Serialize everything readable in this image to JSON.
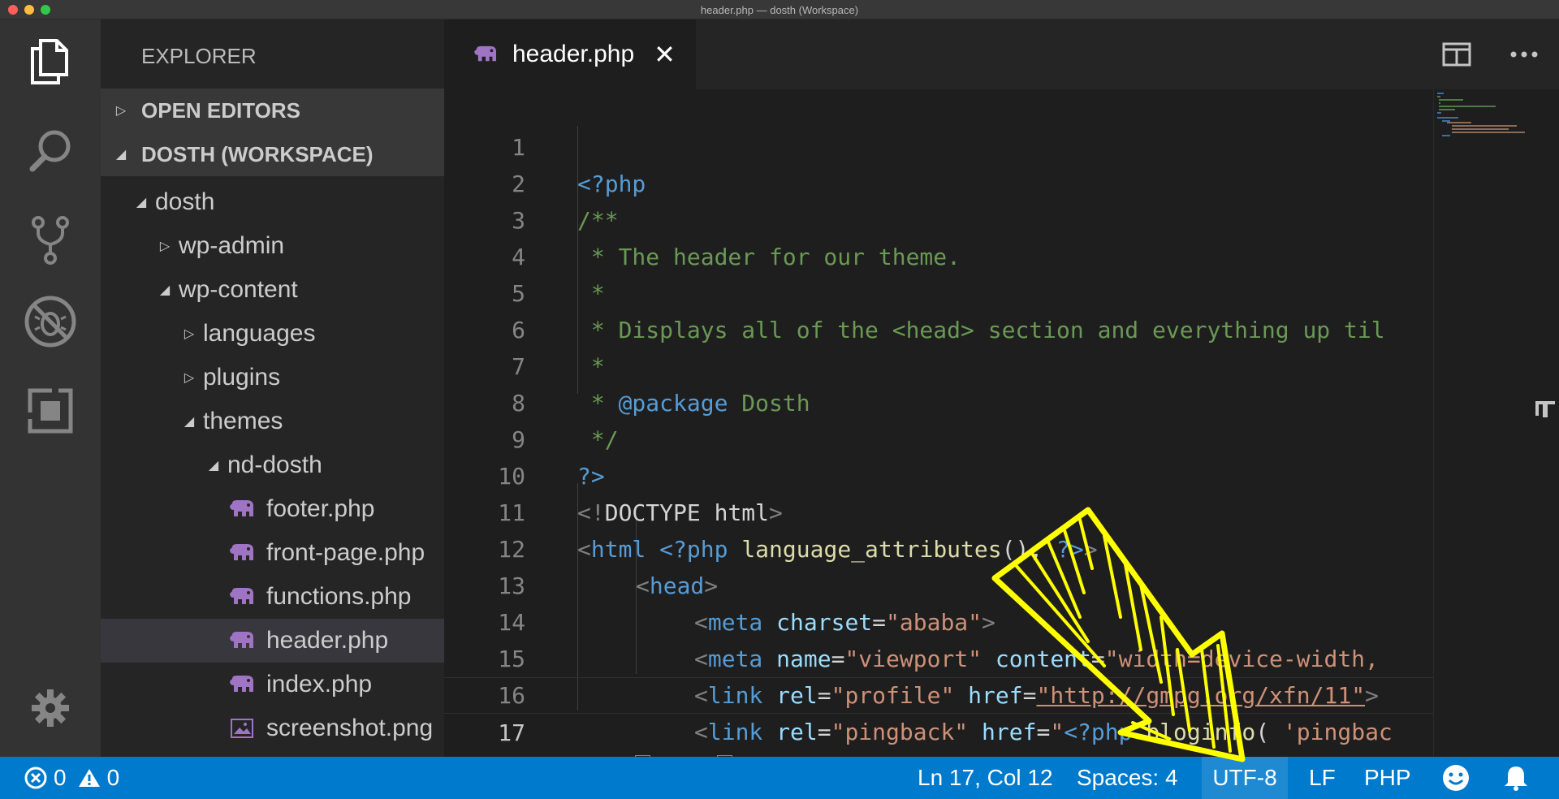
{
  "window": {
    "title": "header.php — dosth (Workspace)"
  },
  "activity_bar": {
    "icons": [
      "files-icon",
      "search-icon",
      "source-control-icon",
      "debug-icon",
      "extensions-icon",
      "gear-icon"
    ]
  },
  "sidebar": {
    "title": "EXPLORER",
    "open_editors": "OPEN EDITORS",
    "workspace": "DOSTH (WORKSPACE)",
    "tree": [
      {
        "label": "dosth",
        "type": "folder-open"
      },
      {
        "label": "wp-admin",
        "type": "folder-closed"
      },
      {
        "label": "wp-content",
        "type": "folder-open"
      },
      {
        "label": "languages",
        "type": "folder-closed"
      },
      {
        "label": "plugins",
        "type": "folder-closed"
      },
      {
        "label": "themes",
        "type": "folder-open"
      },
      {
        "label": "nd-dosth",
        "type": "folder-open"
      },
      {
        "label": "footer.php",
        "type": "php"
      },
      {
        "label": "front-page.php",
        "type": "php"
      },
      {
        "label": "functions.php",
        "type": "php"
      },
      {
        "label": "header.php",
        "type": "php",
        "selected": true
      },
      {
        "label": "index.php",
        "type": "php"
      },
      {
        "label": "screenshot.png",
        "type": "image"
      }
    ]
  },
  "editor": {
    "tab": {
      "label": "header.php",
      "close": "✕"
    },
    "line_numbers": [
      "1",
      "2",
      "3",
      "4",
      "5",
      "6",
      "7",
      "8",
      "9",
      "10",
      "11",
      "12",
      "13",
      "14",
      "15",
      "16",
      "17"
    ]
  },
  "code": {
    "l1": "<?php",
    "l2": "/**",
    "l3": " * The header for our theme.",
    "l4": " *",
    "l5": " * Displays all of the <head> section and everything up til",
    "l6": " *",
    "l7_star": " * ",
    "l7_pkg": "@package",
    "l7_name": " Dosth",
    "l8": " */",
    "l9": "?>",
    "l10_a": "<!",
    "l10_b": "DOCTYPE",
    "l10_c": " html",
    "l10_d": ">",
    "l11_lt": "<",
    "l11_html": "html",
    "l11_sp": " ",
    "l11_php": "<?php",
    "l11_sp2": " ",
    "l11_fn": "language_attributes",
    "l11_paren": "();",
    "l11_sp3": " ",
    "l11_close": "?>",
    "l11_gt": ">",
    "l12_lt": "<",
    "l12_tag": "head",
    "l12_gt": ">",
    "l13_lt": "<",
    "l13_tag": "meta",
    "l13_attr": " charset",
    "l13_eq": "=",
    "l13_val": "\"ababa\"",
    "l13_gt": ">",
    "l14_lt": "<",
    "l14_tag": "meta",
    "l14_attr": " name",
    "l14_eq": "=",
    "l14_val": "\"viewport\"",
    "l14_attr2": " content",
    "l14_eq2": "=",
    "l14_val2": "\"width=device-width,",
    "l15_lt": "<",
    "l15_tag": "link",
    "l15_attr": " rel",
    "l15_eq": "=",
    "l15_val": "\"profile\"",
    "l15_attr2": " href",
    "l15_eq2": "=",
    "l15_val2": "\"http://gmpg.org/xfn/11\"",
    "l15_gt": ">",
    "l16_lt": "<",
    "l16_tag": "link",
    "l16_attr": " rel",
    "l16_eq": "=",
    "l16_val": "\"pingback\"",
    "l16_attr2": " href",
    "l16_eq2": "=",
    "l16_val2": "\"",
    "l16_php": "<?php",
    "l16_fn": " bloginfo",
    "l16_paren": "(",
    "l16_arg": " 'pingbac",
    "l17_lt": "<",
    "l17_slash": "/",
    "l17_tag": "head",
    "l17_gt": ">"
  },
  "status_bar": {
    "errors": "0",
    "warnings": "0",
    "position": "Ln 17, Col 12",
    "spaces": "Spaces: 4",
    "encoding": "UTF-8",
    "eol": "LF",
    "language": "PHP"
  },
  "colors": {
    "status_bar": "#007acc",
    "annotation_arrow": "#ffff00",
    "php_icon": "#a074c4"
  }
}
